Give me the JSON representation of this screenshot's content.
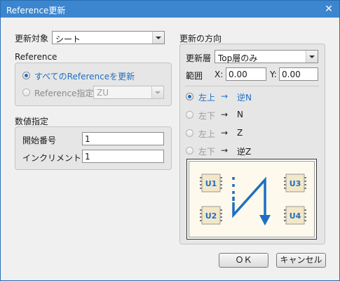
{
  "window": {
    "title": "Reference更新"
  },
  "target": {
    "label": "更新対象",
    "value": "シート"
  },
  "reference": {
    "heading": "Reference",
    "option_all": "すべてのReferenceを更新",
    "option_specified": "Reference指定",
    "specified_value": "ZU"
  },
  "numbering": {
    "heading": "数値指定",
    "start_label": "開始番号",
    "start_value": "1",
    "increment_label": "インクリメント",
    "increment_value": "1"
  },
  "direction": {
    "heading": "更新の方向",
    "layer_label": "更新層",
    "layer_value": "Top層のみ",
    "range_label": "範囲",
    "x_label": "X:",
    "x_value": "0.00",
    "y_label": "Y:",
    "y_value": "0.00",
    "options": [
      {
        "from": "左上",
        "arrow": "→",
        "to": "逆N",
        "selected": true
      },
      {
        "from": "左下",
        "arrow": "→",
        "to": "N",
        "selected": false
      },
      {
        "from": "左上",
        "arrow": "→",
        "to": "Z",
        "selected": false
      },
      {
        "from": "左下",
        "arrow": "→",
        "to": "逆Z",
        "selected": false
      }
    ],
    "preview_chips": [
      "U1",
      "U2",
      "U3",
      "U4"
    ]
  },
  "buttons": {
    "ok": "ＯＫ",
    "cancel": "キャンセル"
  },
  "colors": {
    "accent": "#1f6fc1",
    "titlebar": "#3c86d0",
    "chip": "#1f6fc1",
    "chip_bg": "#f2e8c9"
  }
}
